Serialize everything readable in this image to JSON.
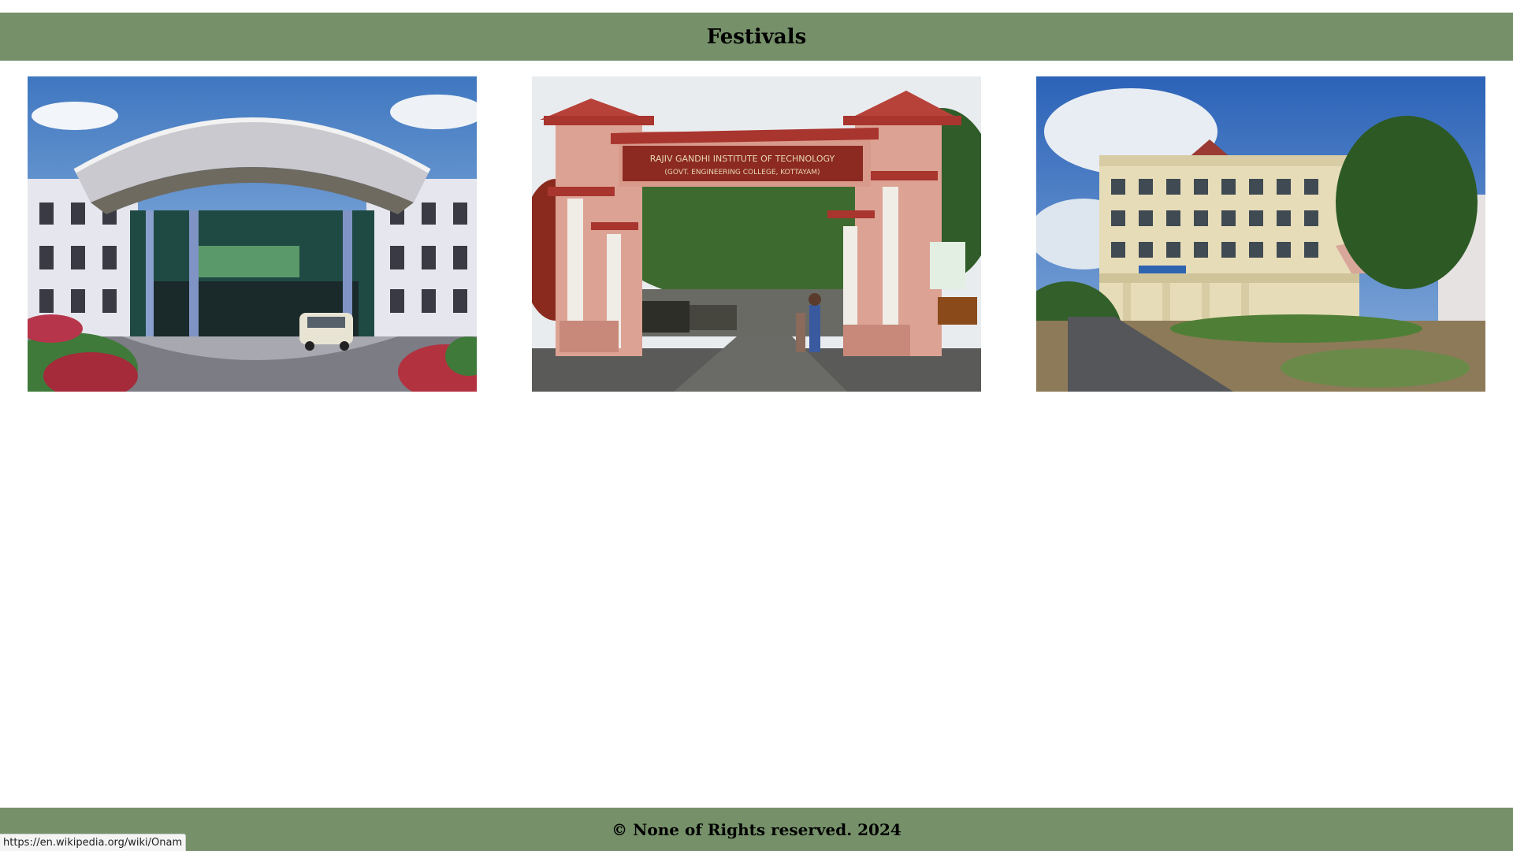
{
  "header": {
    "title": "Festivals"
  },
  "gallery": {
    "images": [
      {
        "alt": "",
        "link": "https://en.wikipedia.org/wiki/Onam"
      },
      {
        "alt": "",
        "sign_line1": "RAJIV GANDHI INSTITUTE OF TECHNOLOGY",
        "sign_line2": "(GOVT. ENGINEERING COLLEGE, KOTTAYAM)"
      },
      {
        "alt": ""
      }
    ]
  },
  "footer": {
    "text": "© None of Rights reserved. 2024"
  },
  "status_bar": {
    "url": "https://en.wikipedia.org/wiki/Onam"
  },
  "colors": {
    "bar": "#76916a",
    "background": "#ffffff"
  }
}
